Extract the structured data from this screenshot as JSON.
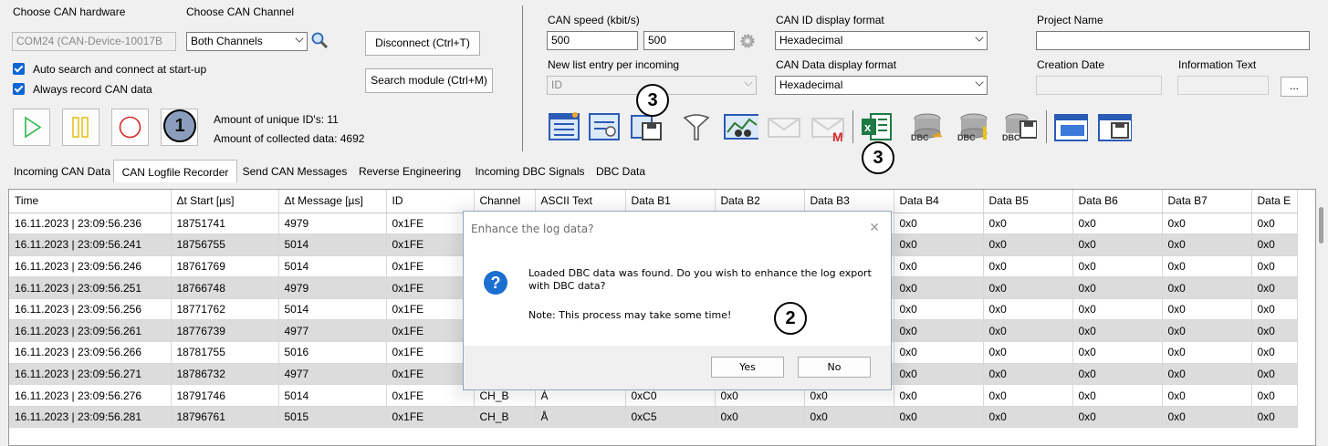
{
  "hardware": {
    "label": "Choose CAN hardware",
    "value": "COM24 (CAN-Device-10017B",
    "channel_label": "Choose CAN Channel",
    "channel_value": "Both Channels",
    "disconnect_button": "Disconnect (Ctrl+T)",
    "search_module_button": "Search module (Ctrl+M)",
    "auto_search_label": "Auto search and connect at start-up",
    "always_record_label": "Always record CAN data"
  },
  "stats": {
    "unique_ids": "Amount of unique ID's: 11",
    "collected_data": "Amount of collected data: 4692"
  },
  "speed": {
    "label": "CAN speed (kbit/s)",
    "value1": "500",
    "value2": "500",
    "new_list_label": "New list entry per incoming",
    "new_list_value": "ID"
  },
  "format": {
    "id_label": "CAN ID display format",
    "id_value": "Hexadecimal",
    "data_label": "CAN Data display format",
    "data_value": "Hexadecimal"
  },
  "project": {
    "name_label": "Project Name",
    "creation_label": "Creation Date",
    "info_label": "Information Text",
    "browse_button": "..."
  },
  "callouts": {
    "one": "1",
    "two": "2",
    "three_a": "3",
    "three_b": "3"
  },
  "tabs": [
    "Incoming CAN Data",
    "CAN Logfile Recorder",
    "Send CAN Messages",
    "Reverse Engineering",
    "Incoming DBC Signals",
    "DBC Data"
  ],
  "active_tab": "CAN Logfile Recorder",
  "columns": [
    "Time",
    "Δt Start [µs]",
    "Δt Message [µs]",
    "ID",
    "Channel",
    "ASCII Text",
    "Data B1",
    "Data B2",
    "Data B3",
    "Data B4",
    "Data B5",
    "Data B6",
    "Data B7",
    "Data E"
  ],
  "rows": [
    [
      "16.11.2023 | 23:09:56.236",
      "18751741",
      "4979",
      "0x1FE",
      "",
      "",
      "",
      "",
      "",
      "0x0",
      "0x0",
      "0x0",
      "0x0",
      "0x0"
    ],
    [
      "16.11.2023 | 23:09:56.241",
      "18756755",
      "5014",
      "0x1FE",
      "",
      "",
      "",
      "",
      "",
      "0x0",
      "0x0",
      "0x0",
      "0x0",
      "0x0"
    ],
    [
      "16.11.2023 | 23:09:56.246",
      "18761769",
      "5014",
      "0x1FE",
      "",
      "",
      "",
      "",
      "",
      "0x0",
      "0x0",
      "0x0",
      "0x0",
      "0x0"
    ],
    [
      "16.11.2023 | 23:09:56.251",
      "18766748",
      "4979",
      "0x1FE",
      "",
      "",
      "",
      "",
      "",
      "0x0",
      "0x0",
      "0x0",
      "0x0",
      "0x0"
    ],
    [
      "16.11.2023 | 23:09:56.256",
      "18771762",
      "5014",
      "0x1FE",
      "",
      "",
      "",
      "",
      "",
      "0x0",
      "0x0",
      "0x0",
      "0x0",
      "0x0"
    ],
    [
      "16.11.2023 | 23:09:56.261",
      "18776739",
      "4977",
      "0x1FE",
      "",
      "",
      "",
      "",
      "",
      "0x0",
      "0x0",
      "0x0",
      "0x0",
      "0x0"
    ],
    [
      "16.11.2023 | 23:09:56.266",
      "18781755",
      "5016",
      "0x1FE",
      "",
      "",
      "",
      "",
      "",
      "0x0",
      "0x0",
      "0x0",
      "0x0",
      "0x0"
    ],
    [
      "16.11.2023 | 23:09:56.271",
      "18786732",
      "4977",
      "0x1FE",
      "",
      "",
      "",
      "",
      "",
      "0x0",
      "0x0",
      "0x0",
      "0x0",
      "0x0"
    ],
    [
      "16.11.2023 | 23:09:56.276",
      "18791746",
      "5014",
      "0x1FE",
      "CH_B",
      "À",
      "0xC0",
      "0x0",
      "0x0",
      "0x0",
      "0x0",
      "0x0",
      "0x0",
      "0x0"
    ],
    [
      "16.11.2023 | 23:09:56.281",
      "18796761",
      "5015",
      "0x1FE",
      "CH_B",
      "Å",
      "0xC5",
      "0x0",
      "0x0",
      "0x0",
      "0x0",
      "0x0",
      "0x0",
      "0x0"
    ]
  ],
  "dialog": {
    "title": "Enhance the log data?",
    "message": "Loaded DBC data was found. Do you wish to enhance the log export with DBC data?",
    "note": "Note: This process may take some time!",
    "yes": "Yes",
    "no": "No"
  },
  "icons": [
    "play-icon",
    "pause-icon",
    "record-icon",
    "list-icon",
    "list-search-icon",
    "save-icon",
    "filter-icon",
    "graph-icon",
    "mail-icon",
    "gmail-icon",
    "excel-icon",
    "dbc-load-icon",
    "dbc-edit-icon",
    "dbc-save-icon",
    "window-icon",
    "window-save-icon"
  ],
  "colors": {
    "excel": "#1d7a44",
    "play": "#2db84a",
    "pause": "#e8c21a",
    "record": "#d62a2a",
    "accent": "#1a6fd0"
  }
}
